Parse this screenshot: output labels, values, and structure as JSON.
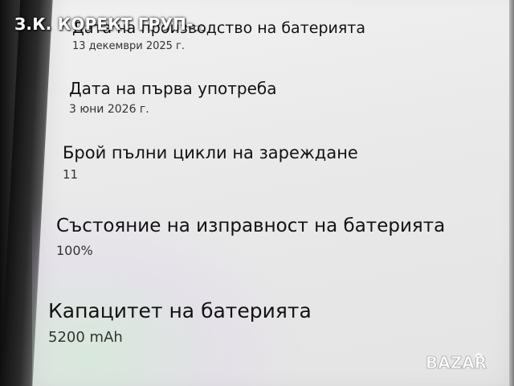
{
  "watermark": {
    "text": "З.К. КОРЕКТ ГРУП-.."
  },
  "battery_info": {
    "items": [
      {
        "title": "Дата на производство на батерията",
        "value": "13 декември 2025 г."
      },
      {
        "title": "Дата на първа употреба",
        "value": "3 юни 2026 г."
      },
      {
        "title": "Брой пълни цикли на зареждане",
        "value": "11"
      },
      {
        "title": "Състояние на изправност на батерията",
        "value": "100%"
      },
      {
        "title": "Капацитет на батерията",
        "value": "5200 mAh"
      }
    ]
  },
  "logo": {
    "text": "BAZAR"
  },
  "colors": {
    "screen_background": "#ececec",
    "text_primary": "#121212",
    "text_secondary": "#333333",
    "watermark_text": "#ffffff"
  }
}
